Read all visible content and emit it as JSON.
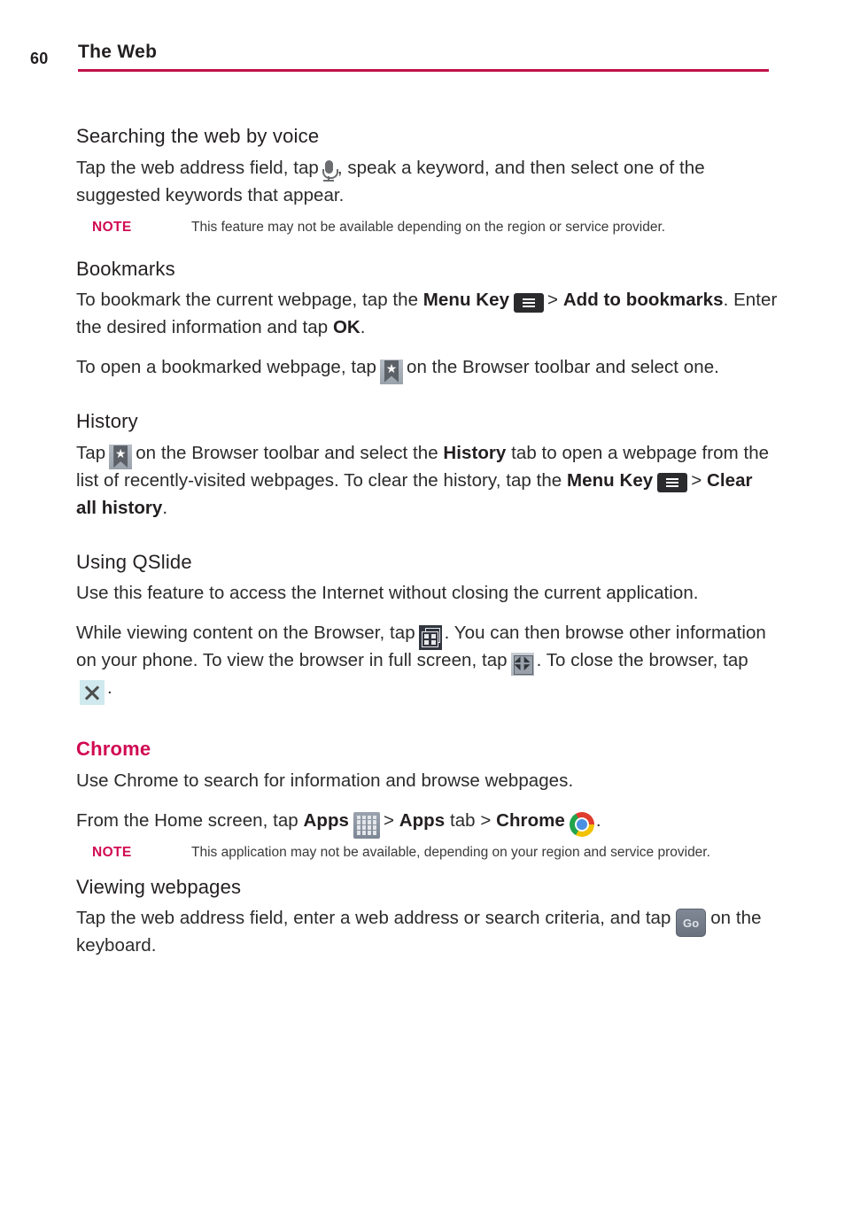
{
  "header": {
    "page_number": "60",
    "title": "The Web",
    "rule_color": "#c1104a"
  },
  "accent_color": "#d10a52",
  "sections": [
    {
      "id": "searching-by-voice",
      "heading": "Searching the web by voice",
      "paragraph_part1": "Tap the web address field, tap",
      "icon": "microphone-icon",
      "paragraph_part2": ", speak a keyword, and then select one of the suggested keywords that appear.",
      "note": {
        "label": "NOTE",
        "text": "This feature may not be available depending on the region or service provider."
      }
    },
    {
      "id": "bookmarks",
      "heading": "Bookmarks",
      "p1_a": "To bookmark the current webpage, tap the",
      "p1_menu_key": "Menu Key",
      "p1_b": ">",
      "p1_c": "Add to bookmarks",
      "p1_d": ". Enter the desired information and tap",
      "p1_ok": "OK",
      "p1_e": ".",
      "p2_a": "To open a bookmarked webpage, tap",
      "p2_b": "on the Browser toolbar and select one."
    },
    {
      "id": "history",
      "heading": "History",
      "p1_a": "Tap",
      "p1_b": "on the Browser toolbar and select the",
      "p1_history": "History",
      "p1_c": "tab to open a webpage from the list of recently-visited webpages. To clear the history, tap the",
      "p1_menu_key": "Menu Key",
      "p1_d": ">",
      "p1_clear": "Clear all history",
      "p1_e": "."
    },
    {
      "id": "using-qslide",
      "heading": "Using QSlide",
      "p1": "Use this feature to access the Internet without closing the current application.",
      "p2_a": "While viewing content on the Browser, tap",
      "p2_b": ". You can then browse other information on your phone. To view the browser in full screen, tap",
      "p2_c": ". To close the browser, tap",
      "p2_d": "."
    },
    {
      "id": "chrome",
      "heading": "Chrome",
      "p1": "Use Chrome to search for information and browse webpages.",
      "p2_a": "From the Home screen, tap",
      "p2_apps": "Apps",
      "p2_b": ">",
      "p2_apps_tab": "Apps",
      "p2_c": "tab >",
      "p2_chrome": "Chrome",
      "p2_d": ".",
      "note": {
        "label": "NOTE",
        "text": "This application may not be available, depending on your region and service provider."
      }
    },
    {
      "id": "viewing-webpages",
      "heading": "Viewing webpages",
      "p1_a": "Tap the web address field, enter a web address or search criteria, and tap",
      "p1_b": "on the keyboard."
    }
  ],
  "icons": {
    "microphone": "microphone-icon",
    "menu_key": "menu-key-icon",
    "bookmark": "bookmark-star-icon",
    "qslide": "qslide-icon",
    "fullscreen": "fullscreen-icon",
    "close": "close-icon",
    "apps": "apps-grid-icon",
    "chrome": "chrome-logo-icon",
    "go_key_label": "Go"
  }
}
